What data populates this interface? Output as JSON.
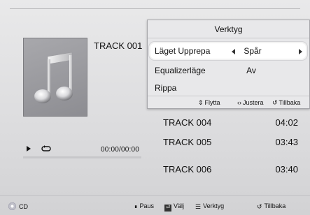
{
  "now_playing": {
    "track_title": "TRACK 001",
    "time": "00:00/00:00",
    "progress": 0
  },
  "playlist": [
    {
      "name": "TRACK 004",
      "duration": "04:02"
    },
    {
      "name": "TRACK 005",
      "duration": "03:43"
    },
    {
      "name": "TRACK 006",
      "duration": "03:40"
    }
  ],
  "popup": {
    "title": "Verktyg",
    "items": [
      {
        "label": "Läget Upprepa",
        "value": "Spår"
      },
      {
        "label": "Equalizerläge",
        "value": "Av"
      },
      {
        "label": "Rippa",
        "value": ""
      }
    ],
    "hints": [
      {
        "icon": "updown-arrows-icon",
        "label": "Flytta"
      },
      {
        "icon": "leftright-arrows-icon",
        "label": "Justera"
      },
      {
        "icon": "return-icon",
        "label": "Tillbaka"
      }
    ]
  },
  "footer": {
    "source_label": "CD",
    "buttons": [
      {
        "icon": "pause-key-icon",
        "label": "Paus"
      },
      {
        "icon": "enter-key-icon",
        "label": "Välj"
      },
      {
        "icon": "tools-key-icon",
        "label": "Verktyg"
      },
      {
        "icon": "return-icon",
        "label": "Tillbaka"
      }
    ]
  }
}
